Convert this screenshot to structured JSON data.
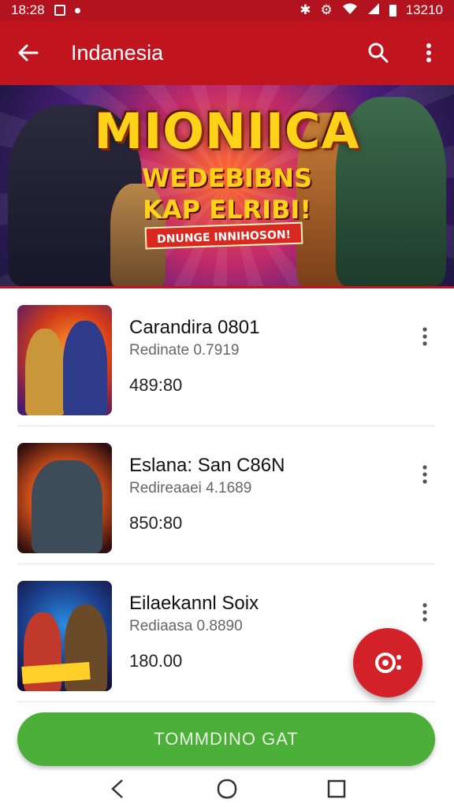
{
  "status_bar": {
    "time": "18:28",
    "right_time": "13210",
    "icons": [
      "notification-icon",
      "dot-icon",
      "bluetooth-icon",
      "settings-icon",
      "nfc-icon",
      "wifi-icon",
      "signal-icon",
      "battery-icon"
    ]
  },
  "app_bar": {
    "title": "Indanesia",
    "icons": [
      "back-arrow-icon",
      "search-icon",
      "more-vert-icon"
    ]
  },
  "banner": {
    "title": "MIONIICA",
    "subtitle_line1": "WEDEBIBNS",
    "subtitle_line2": "KAP ELRIBI!",
    "tag": "DNUNGE INNIHOSON!"
  },
  "items": [
    {
      "title": "Carandira 0801",
      "subtitle": "Redinate 0.7919",
      "price": "489:80"
    },
    {
      "title": "Eslana: San C86N",
      "subtitle": "Redireaaei 4.1689",
      "price": "850:80"
    },
    {
      "title": "Eilaekannl Soix",
      "subtitle": "Rediaasa 0.8890",
      "price": "180.00"
    }
  ],
  "fab": {
    "icon": "camera-icon"
  },
  "cta": {
    "label": "TOMMDINO GAT"
  },
  "nav": {
    "icons": [
      "nav-back-icon",
      "nav-home-icon",
      "nav-recents-icon"
    ]
  },
  "colors": {
    "primary": "#c0141f",
    "accent": "#d3212a",
    "cta": "#4caf3a"
  }
}
